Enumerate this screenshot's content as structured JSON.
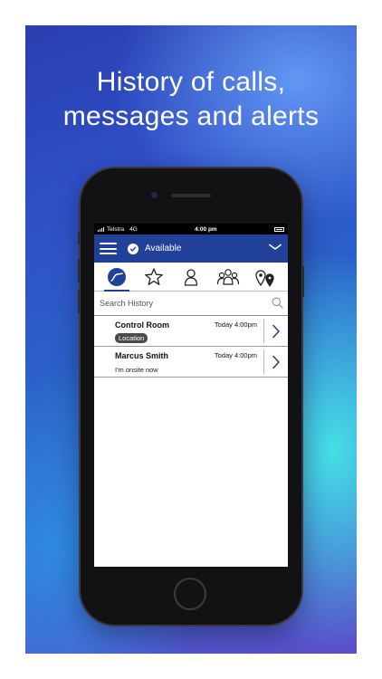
{
  "promo": {
    "headline_line1": "History of calls,",
    "headline_line2": "messages and alerts"
  },
  "statusbar": {
    "carrier": "Telstra",
    "network": "4G",
    "time": "4:00 pm"
  },
  "header": {
    "status_label": "Available",
    "status_icon": "check-circle-icon",
    "menu_icon": "hamburger-menu-icon",
    "expand_icon": "chevron-down-icon",
    "background_color": "#21409a"
  },
  "tabs": [
    {
      "icon": "history-icon",
      "active": true
    },
    {
      "icon": "star-icon",
      "active": false
    },
    {
      "icon": "person-icon",
      "active": false
    },
    {
      "icon": "group-icon",
      "active": false
    },
    {
      "icon": "location-pins-icon",
      "active": false
    }
  ],
  "search": {
    "placeholder": "Search History",
    "icon": "search-icon"
  },
  "history": [
    {
      "name": "Control Room",
      "time": "Today 4:00pm",
      "badge": "Location"
    },
    {
      "name": "Marcus Smith",
      "time": "Today 4:00pm",
      "preview": "I'm onsite now"
    }
  ]
}
